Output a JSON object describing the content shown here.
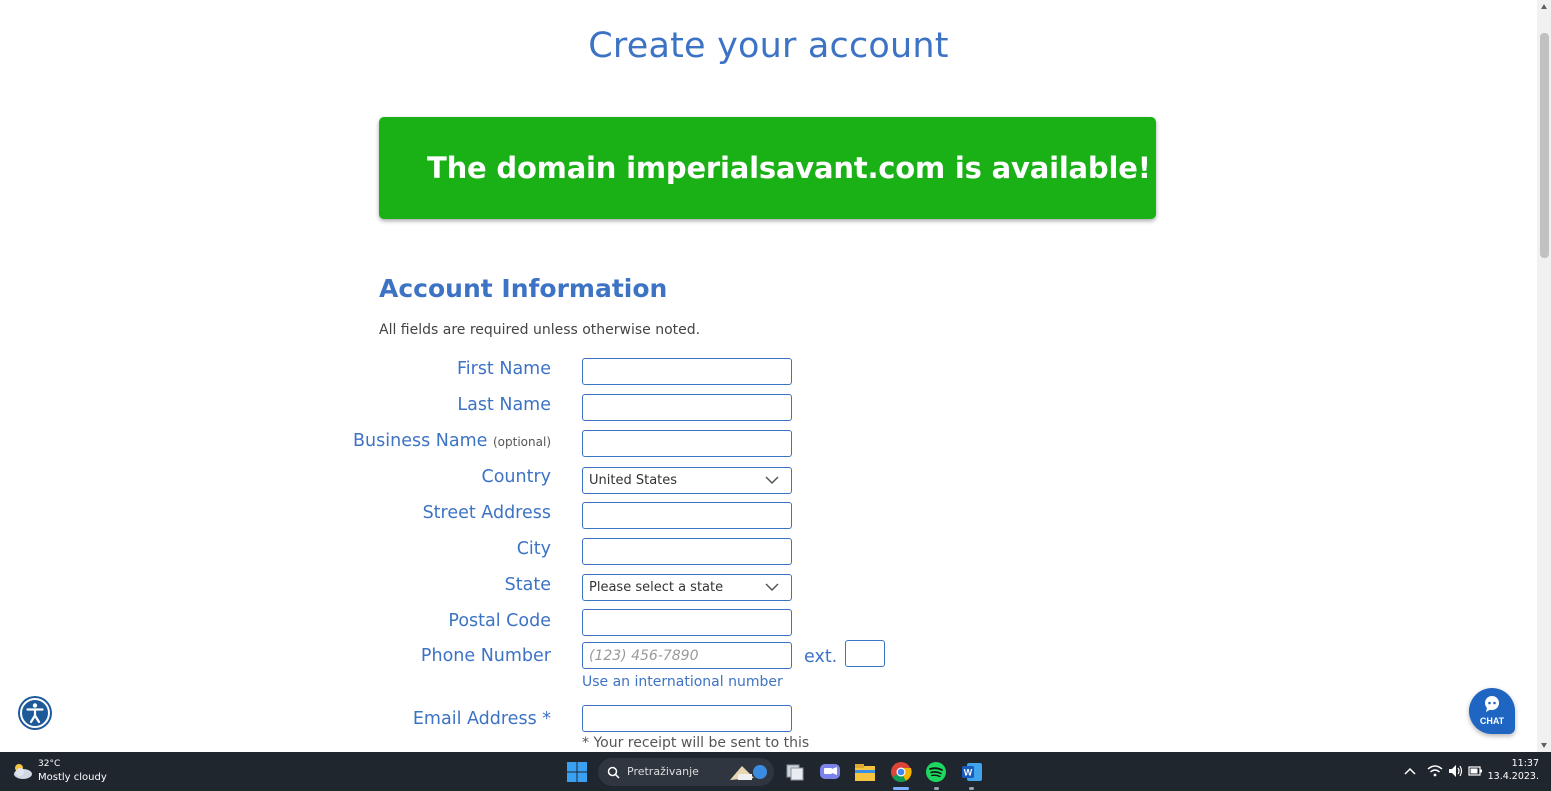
{
  "page": {
    "title": "Create your account",
    "banner": "The domain imperialsavant.com is available!",
    "section_title": "Account Information",
    "required_note": "All fields are required unless otherwise noted."
  },
  "form": {
    "first_name_label": "First Name",
    "last_name_label": "Last Name",
    "business_name_label": "Business Name",
    "business_name_optional": "(optional)",
    "country_label": "Country",
    "country_value": "United States",
    "street_label": "Street Address",
    "city_label": "City",
    "state_label": "State",
    "state_value": "Please select a state",
    "postal_label": "Postal Code",
    "phone_label": "Phone Number",
    "phone_placeholder": "(123) 456-7890",
    "ext_label": "ext.",
    "intl_link": "Use an international number",
    "email_label": "Email Address *",
    "receipt_note": "* Your receipt will be sent to this"
  },
  "widgets": {
    "chat_label": "CHAT",
    "accessibility_icon": "accessibility-icon",
    "chat_icon": "chat-bubble-icon"
  },
  "taskbar": {
    "weather_temp": "32°C",
    "weather_condition": "Mostly cloudy",
    "search_text": "Pretraživanje",
    "time": "11:37",
    "date": "13.4.2023."
  },
  "colors": {
    "accent_blue": "#3d73c4",
    "banner_green": "#19b116",
    "taskbar_bg": "#20262e"
  }
}
